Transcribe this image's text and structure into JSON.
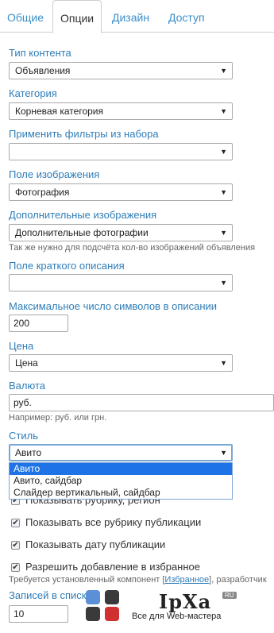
{
  "tabs": [
    "Общие",
    "Опции",
    "Дизайн",
    "Доступ"
  ],
  "fields": {
    "content_type": {
      "label": "Тип контента",
      "value": "Объявления"
    },
    "category": {
      "label": "Категория",
      "value": "Корневая категория"
    },
    "filters": {
      "label": "Применить фильтры из набора",
      "value": ""
    },
    "image_field": {
      "label": "Поле изображения",
      "value": "Фотография"
    },
    "extra_images": {
      "label": "Дополнительные изображения",
      "value": "Дополнительные фотографии",
      "hint": "Так же нужно для подсчёта кол-во изображений объявления"
    },
    "short_desc": {
      "label": "Поле краткого описания",
      "value": ""
    },
    "max_chars": {
      "label": "Максимальное число символов в описании",
      "value": "200"
    },
    "price": {
      "label": "Цена",
      "value": "Цена"
    },
    "currency": {
      "label": "Валюта",
      "value": "руб.",
      "hint": "Например: руб. или грн."
    },
    "style": {
      "label": "Стиль",
      "value": "Авито",
      "options": [
        "Авито",
        "Авито, сайдбар",
        "Слайдер вертикальный, сайдбар"
      ]
    }
  },
  "checks": {
    "c1": "Показывать рубрику, регион",
    "c2": "Показывать все рубрику публикации",
    "c3": "Показывать дату публикации",
    "c4": "Разрешить добавление в избранное",
    "c4_hint_pre": "Требуется установленный компонент [",
    "c4_hint_link": "Избранное",
    "c4_hint_post": "], разработчик"
  },
  "records": {
    "label": "Записей в списке",
    "value": "10"
  },
  "watermark": {
    "brand": "IpXa",
    "badge": "RU",
    "tagline": "Все для Web-мастера",
    "colors": [
      "#5b8fd6",
      "#3a3a3a",
      "#3a3a3a",
      "#d03030"
    ]
  }
}
